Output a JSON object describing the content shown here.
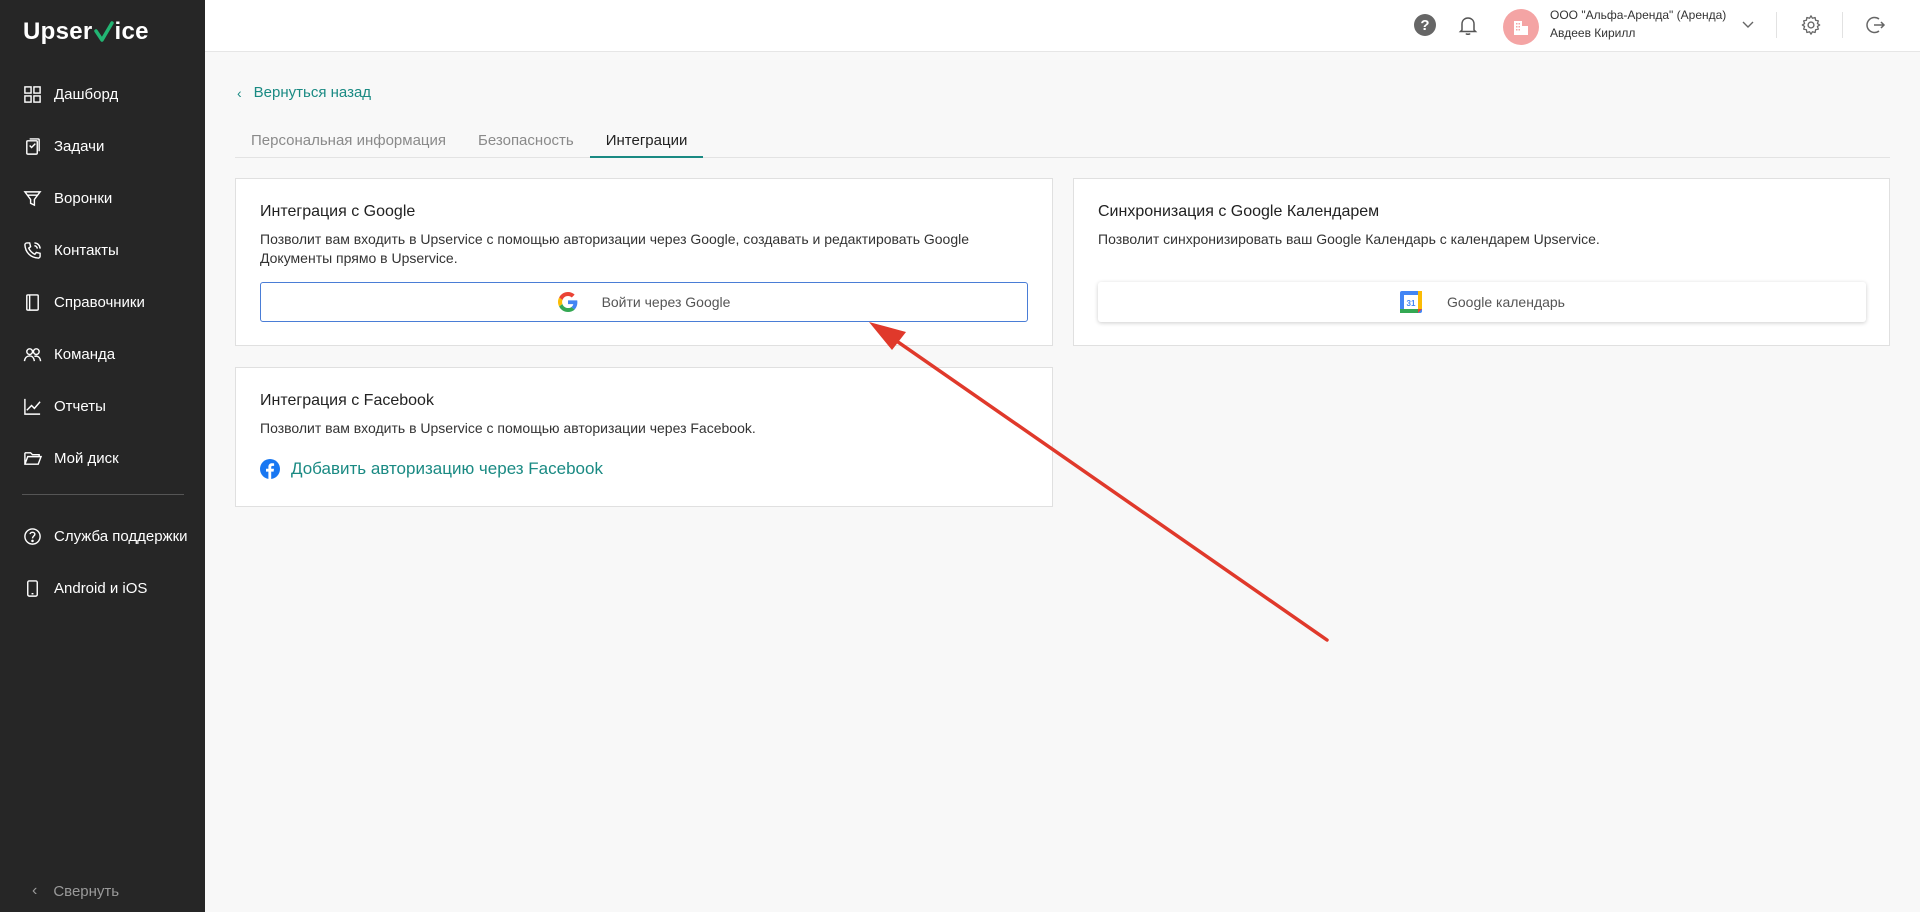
{
  "app": {
    "logo_left": "Upser",
    "logo_v": "V",
    "logo_right": "ice"
  },
  "sidebar": {
    "items": [
      {
        "label": "Дашборд",
        "icon": "dashboard-icon"
      },
      {
        "label": "Задачи",
        "icon": "tasks-icon"
      },
      {
        "label": "Воронки",
        "icon": "funnel-icon"
      },
      {
        "label": "Контакты",
        "icon": "contacts-icon"
      },
      {
        "label": "Справочники",
        "icon": "book-icon"
      },
      {
        "label": "Команда",
        "icon": "team-icon"
      },
      {
        "label": "Отчеты",
        "icon": "chart-icon"
      },
      {
        "label": "Мой диск",
        "icon": "folder-icon"
      }
    ],
    "secondary": [
      {
        "label": "Служба поддержки",
        "icon": "help-circle-icon"
      },
      {
        "label": "Android и iOS",
        "icon": "phone-icon"
      }
    ],
    "collapse_label": "Свернуть"
  },
  "header": {
    "help_glyph": "?",
    "company": "ООО \"Альфа-Аренда\" (Аренда)",
    "user": "Авдеев Кирилл"
  },
  "main": {
    "back_label": "Вернуться назад",
    "tabs": [
      {
        "label": "Персональная информация",
        "active": false
      },
      {
        "label": "Безопасность",
        "active": false
      },
      {
        "label": "Интеграции",
        "active": true
      }
    ],
    "google": {
      "title": "Интеграция с Google",
      "desc_line1": "Позволит вам входить в Upservice с помощью авторизации через Google, создавать и редактировать Google",
      "desc_line2": "Документы прямо в Upservice.",
      "button": "Войти через Google"
    },
    "calendar": {
      "title": "Синхронизация с Google Календарем",
      "desc": "Позволит синхронизировать ваш Google Календарь с календарем Upservice.",
      "button": "Google календарь",
      "icon_day": "31"
    },
    "facebook": {
      "title": "Интеграция с Facebook",
      "desc": "Позволит вам входить в Upservice с помощью авторизации через Facebook.",
      "link": "Добавить авторизацию через Facebook"
    }
  },
  "colors": {
    "accent": "#1a8a83",
    "sidebar_bg": "#262626",
    "annotation_arrow": "#e0392b"
  }
}
